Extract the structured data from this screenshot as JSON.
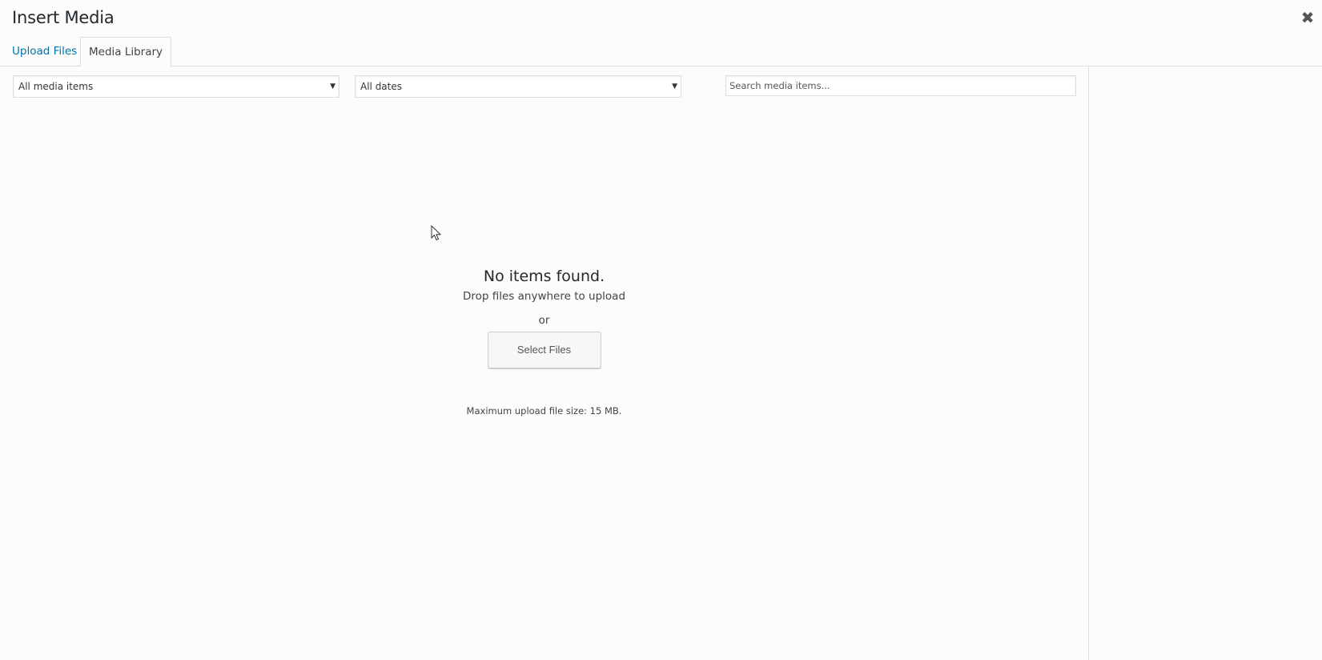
{
  "modal": {
    "title": "Insert Media",
    "close_symbol": "✖"
  },
  "tabs": [
    {
      "label": "Upload Files",
      "active": false
    },
    {
      "label": "Media Library",
      "active": true
    }
  ],
  "filters": {
    "type": {
      "selected": "All media items"
    },
    "date": {
      "selected": "All dates"
    },
    "dropdown_arrow": "▼"
  },
  "search": {
    "placeholder": "Search media items...",
    "value": ""
  },
  "empty_state": {
    "title": "No items found.",
    "instructions": "Drop files anywhere to upload",
    "or": "or",
    "button_label": "Select Files",
    "max_size": "Maximum upload file size: 15 MB."
  },
  "colors": {
    "link": "#0073aa",
    "border": "#dddddd",
    "background": "#fcfcfc"
  }
}
